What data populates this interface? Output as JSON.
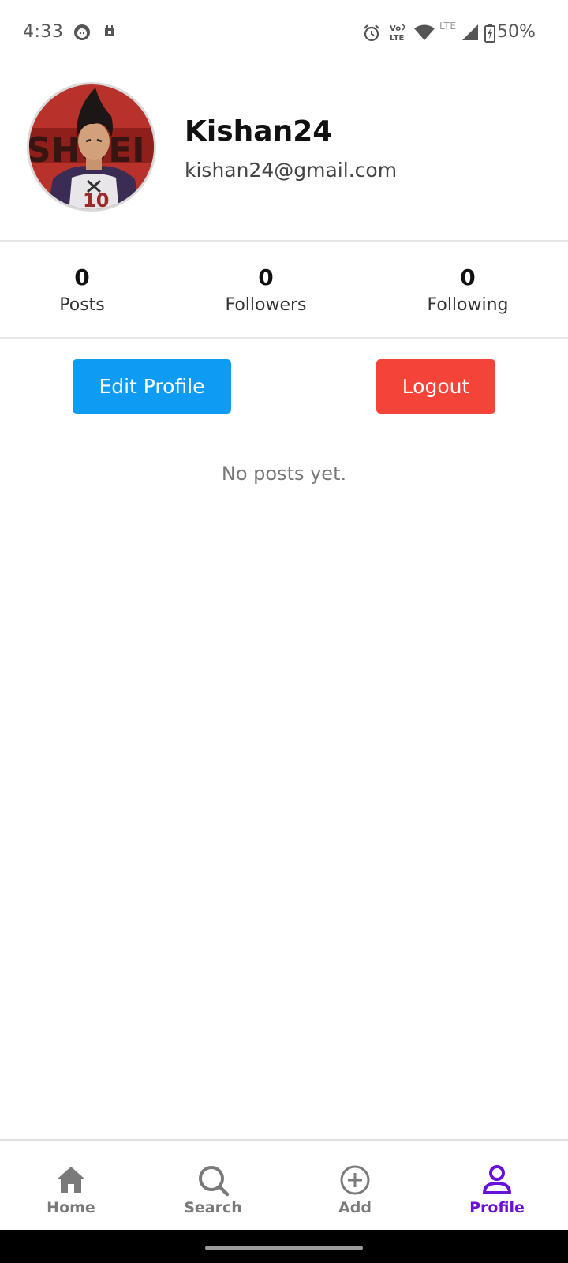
{
  "status_bar": {
    "time": "4:33",
    "network": "LTE",
    "battery": "50%",
    "icons": [
      "face-notification-icon",
      "calendar-notification-icon",
      "alarm-icon",
      "volte-icon",
      "wifi-icon",
      "signal-icon",
      "battery-charging-icon"
    ]
  },
  "profile": {
    "username": "Kishan24",
    "email": "kishan24@gmail.com",
    "avatar_icon": "avatar-image"
  },
  "stats": [
    {
      "value": "0",
      "label": "Posts"
    },
    {
      "value": "0",
      "label": "Followers"
    },
    {
      "value": "0",
      "label": "Following"
    }
  ],
  "actions": {
    "edit_profile": "Edit Profile",
    "logout": "Logout",
    "edit_color": "#0e9bf4",
    "logout_color": "#f4443a"
  },
  "posts": {
    "empty_message": "No posts yet."
  },
  "bottom_nav": {
    "active_color": "#6a11d9",
    "items": [
      {
        "label": "Home",
        "icon": "home-icon"
      },
      {
        "label": "Search",
        "icon": "search-icon"
      },
      {
        "label": "Add",
        "icon": "add-circle-icon"
      },
      {
        "label": "Profile",
        "icon": "person-icon",
        "active": true
      }
    ]
  }
}
